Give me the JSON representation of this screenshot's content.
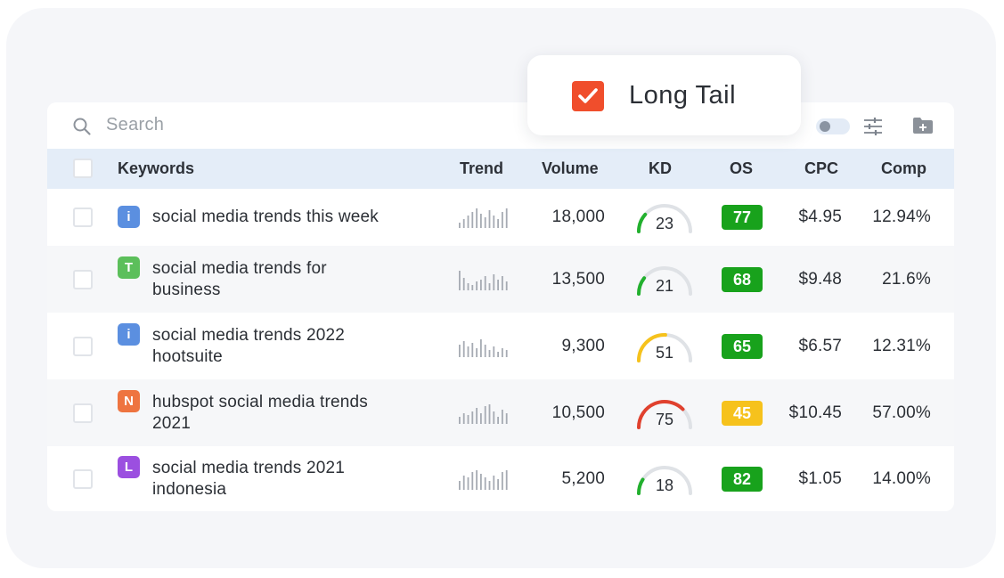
{
  "search": {
    "placeholder": "Search"
  },
  "popup": {
    "label": "Long Tail",
    "checked": true,
    "color": "#f04e2c"
  },
  "table": {
    "headers": {
      "keywords": "Keywords",
      "trend": "Trend",
      "volume": "Volume",
      "kd": "KD",
      "os": "OS",
      "cpc": "CPC",
      "comp": "Comp"
    },
    "rows": [
      {
        "badge": "i",
        "badge_color": "#5b8fe0",
        "keyword_lines": [
          "social media trends this week"
        ],
        "volume": "18,000",
        "kd": "23",
        "kd_color": "#22b02e",
        "os": "77",
        "os_color": "#18a21c",
        "cpc": "$4.95",
        "comp": "12.94%"
      },
      {
        "badge": "T",
        "badge_color": "#5cbf5b",
        "keyword_lines": [
          "social media trends for",
          "business"
        ],
        "volume": "13,500",
        "kd": "21",
        "kd_color": "#22b02e",
        "os": "68",
        "os_color": "#18a21c",
        "cpc": "$9.48",
        "comp": "21.6%"
      },
      {
        "badge": "i",
        "badge_color": "#5b8fe0",
        "keyword_lines": [
          "social media trends 2022",
          "hootsuite"
        ],
        "volume": "9,300",
        "kd": "51",
        "kd_color": "#f6c21c",
        "os": "65",
        "os_color": "#18a21c",
        "cpc": "$6.57",
        "comp": "12.31%"
      },
      {
        "badge": "N",
        "badge_color": "#ee7440",
        "keyword_lines": [
          "hubspot social media trends",
          "2021"
        ],
        "volume": "10,500",
        "kd": "75",
        "kd_color": "#e0412e",
        "os": "45",
        "os_color": "#f6c21c",
        "cpc": "$10.45",
        "comp": "57.00%"
      },
      {
        "badge": "L",
        "badge_color": "#9b4fe0",
        "keyword_lines": [
          "social media trends 2021",
          "indonesia"
        ],
        "volume": "5,200",
        "kd": "18",
        "kd_color": "#22b02e",
        "os": "82",
        "os_color": "#18a21c",
        "cpc": "$1.05",
        "comp": "14.00%"
      }
    ]
  },
  "icons": [
    "search-icon",
    "toggle-switch",
    "filter-sliders-icon",
    "add-folder-icon",
    "check-icon"
  ]
}
